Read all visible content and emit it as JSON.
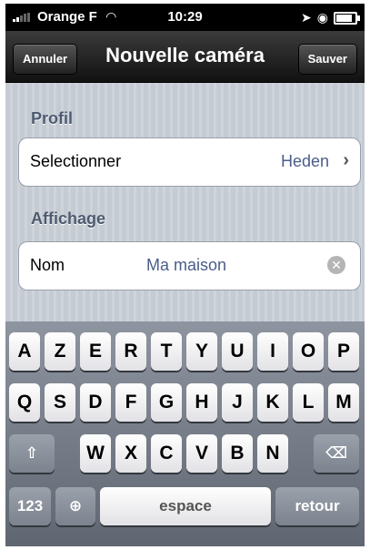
{
  "status_bar": {
    "carrier": "Orange F",
    "time": "10:29"
  },
  "navbar": {
    "title": "Nouvelle caméra",
    "left_button": "Annuler",
    "right_button": "Sauver"
  },
  "sections": [
    {
      "header": "Profil",
      "cell_label": "Selectionner",
      "cell_value": "Heden"
    },
    {
      "header": "Affichage",
      "cell_label": "Nom",
      "cell_value": "Ma maison"
    }
  ],
  "keyboard": {
    "row1": [
      "A",
      "Z",
      "E",
      "R",
      "T",
      "Y",
      "U",
      "I",
      "O",
      "P"
    ],
    "row2": [
      "Q",
      "S",
      "D",
      "F",
      "G",
      "H",
      "J",
      "K",
      "L",
      "M"
    ],
    "row3": [
      "W",
      "X",
      "C",
      "V",
      "B",
      "N"
    ],
    "numbers_key": "123",
    "space_key": "espace",
    "return_key": "retour"
  }
}
